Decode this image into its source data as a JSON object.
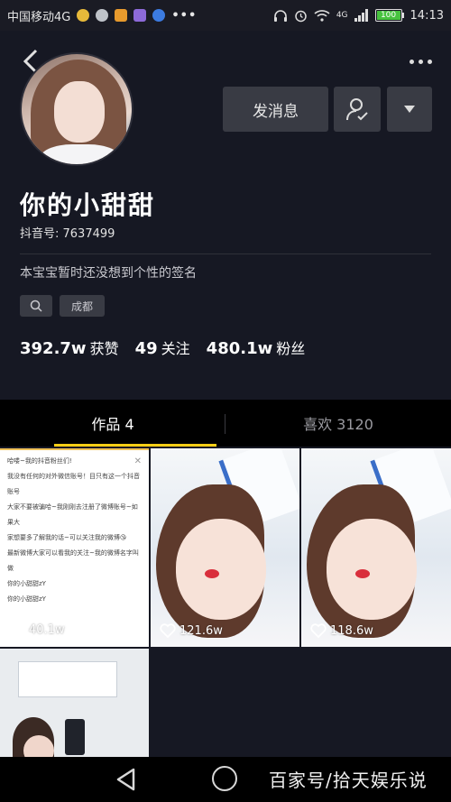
{
  "statusbar": {
    "carrier": "中国移动4G",
    "network": "4G",
    "battery": "100",
    "time": "14:13"
  },
  "profile": {
    "name": "你的小甜甜",
    "douyin_id": "抖音号: 7637499",
    "signature": "本宝宝暂时还没想到个性的签名",
    "city": "成都"
  },
  "actions": {
    "message_label": "发消息"
  },
  "stats": {
    "likes_value": "392.7w",
    "likes_label": "获赞",
    "following_value": "49",
    "following_label": "关注",
    "followers_value": "480.1w",
    "followers_label": "粉丝"
  },
  "tabs": {
    "works": "作品 4",
    "likes": "喜欢 3120"
  },
  "videos": [
    {
      "likes": "40.1w",
      "caption_lines": [
        "哈喽~我的抖音粉丝们!",
        "我没有任何的对外微信账号！目只有这一个抖音账号",
        "大家不要被骗哈~我刚刚去注册了微博账号~如果大",
        "家想要多了解我的话~可以关注我的微博😘",
        "最新微博大家可以看我的关注~我的微博名字叫做",
        "你的小甜甜zY",
        "你的小甜甜zY"
      ]
    },
    {
      "likes": "121.6w"
    },
    {
      "likes": "118.6w"
    },
    {
      "likes": ""
    }
  ],
  "watermark": "百家号/拾天娱乐说",
  "colors": {
    "background": "#161823",
    "accent": "#face15",
    "button": "#393b44"
  }
}
